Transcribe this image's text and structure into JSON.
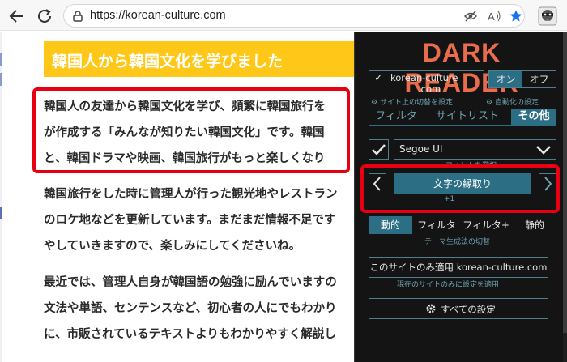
{
  "browser": {
    "url": "https://korean-culture.com"
  },
  "colors": {
    "heading_bg": "#ffc819",
    "highlight_red": "#e60012",
    "dr_accent": "#e96c4c",
    "dr_active": "#2c6f85",
    "dr_hint": "#6fa3b3"
  },
  "page": {
    "heading": "韓国人から韓国文化を学びました",
    "paragraphs": [
      [
        "韓国人の友達から韓国文化を学び、頻繁に韓国旅行を",
        "が作成する「みんなが知りたい韓国文化」です。韓国",
        "と、韓国ドラマや映画、韓国旅行がもっと楽しくなり"
      ],
      [
        "韓国旅行をした時に管理人が行った観光地やレストラン",
        "のロケ地などを更新しています。まだまだ情報不足です",
        "やしていきますので、楽しみにしてくださいね。"
      ],
      [
        "最近では、管理人自身が韓国語の勉強に励んでいますの",
        "文法や単語、センテンスなど、初心者の人にでもわかり",
        "に、市販されているテキストよりもわかりやすく解説し"
      ]
    ]
  },
  "dark_reader": {
    "title": "DARK READER",
    "site_toggle": {
      "site_name": "korean-culture",
      "site_suffix": ".com",
      "hint": "サイト上の切替を設定"
    },
    "on_label": "オン",
    "off_label": "オフ",
    "auto_hint": "自動化の設定",
    "tabs": [
      "フィルタ",
      "サイトリスト",
      "その他"
    ],
    "font": {
      "value": "Segoe UI",
      "hint": "フォントを選択"
    },
    "stroke": {
      "label": "文字の縁取り",
      "value": "+1"
    },
    "modes": [
      "動的",
      "フィルタ",
      "フィルタ+",
      "静的"
    ],
    "mode_hint": "テーマ生成法の切替",
    "site_only_button": "このサイトのみ適用 korean-culture.com",
    "site_only_hint": "現在のサイトのみに設定を適用",
    "all_settings": "すべての設定"
  }
}
